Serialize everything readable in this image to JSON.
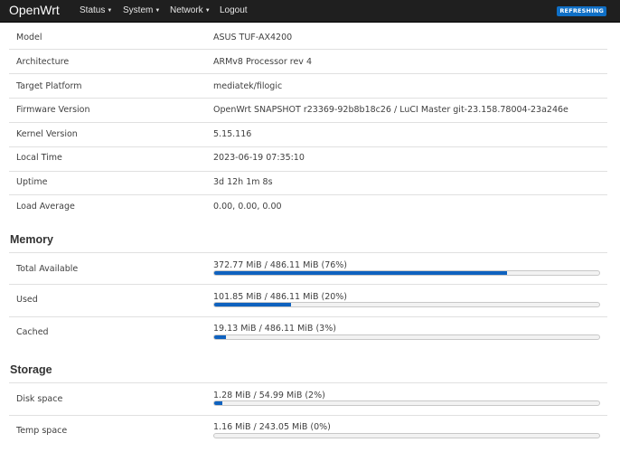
{
  "nav": {
    "brand": "OpenWrt",
    "items": [
      {
        "label": "Status",
        "caret": "▼"
      },
      {
        "label": "System",
        "caret": "▼"
      },
      {
        "label": "Network",
        "caret": "▼"
      },
      {
        "label": "Logout",
        "caret": ""
      }
    ],
    "status_badge": "REFRESHING"
  },
  "system": [
    {
      "label": "Model",
      "value": "ASUS TUF-AX4200"
    },
    {
      "label": "Architecture",
      "value": "ARMv8 Processor rev 4"
    },
    {
      "label": "Target Platform",
      "value": "mediatek/filogic"
    },
    {
      "label": "Firmware Version",
      "value": "OpenWrt SNAPSHOT r23369-92b8b18c26 / LuCI Master git-23.158.78004-23a246e"
    },
    {
      "label": "Kernel Version",
      "value": "5.15.116"
    },
    {
      "label": "Local Time",
      "value": "2023-06-19 07:35:10"
    },
    {
      "label": "Uptime",
      "value": "3d 12h 1m 8s"
    },
    {
      "label": "Load Average",
      "value": "0.00, 0.00, 0.00"
    }
  ],
  "memory": {
    "title": "Memory",
    "rows": [
      {
        "label": "Total Available",
        "text": "372.77 MiB / 486.11 MiB (76%)",
        "fraction": 0.76
      },
      {
        "label": "Used",
        "text": "101.85 MiB / 486.11 MiB (20%)",
        "fraction": 0.2
      },
      {
        "label": "Cached",
        "text": "19.13 MiB / 486.11 MiB (3%)",
        "fraction": 0.03
      }
    ]
  },
  "storage": {
    "title": "Storage",
    "rows": [
      {
        "label": "Disk space",
        "text": "1.28 MiB / 54.99 MiB (2%)",
        "fraction": 0.02
      },
      {
        "label": "Temp space",
        "text": "1.16 MiB / 243.05 MiB (0%)",
        "fraction": 0.0
      }
    ]
  },
  "colors": {
    "navbar": "#1f1f1f",
    "accent": "#0f62bf",
    "badge": "#0f6fc6"
  }
}
